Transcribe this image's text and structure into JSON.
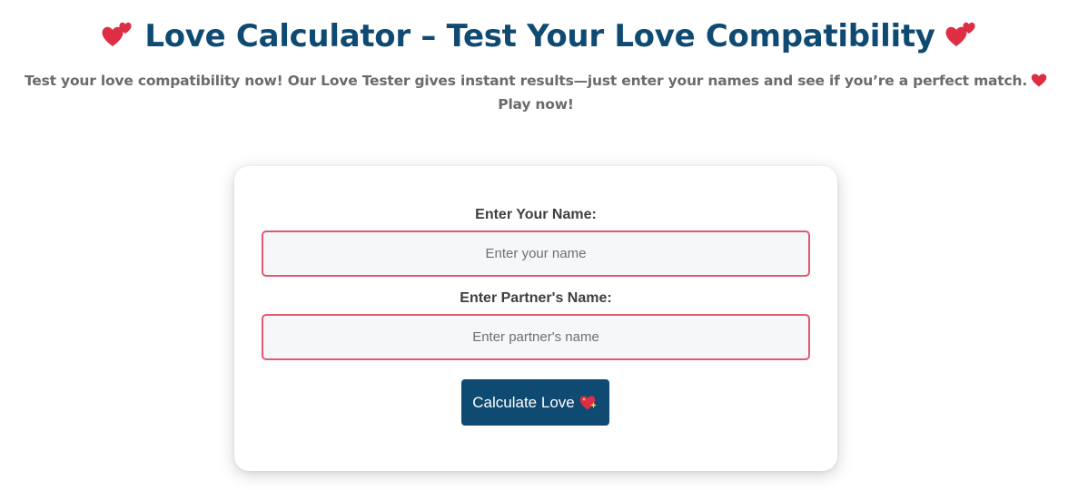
{
  "header": {
    "title": "Love Calculator – Test Your Love Compatibility",
    "left_icon": "two-hearts-icon",
    "right_icon": "two-hearts-icon",
    "subtitle": "Test your love compatibility now! Our Love Tester gives instant results—just enter your names and see if you’re a perfect match.",
    "subtitle_icon": "red-heart-icon",
    "subtitle_end": "Play now!"
  },
  "form": {
    "your_name_label": "Enter Your Name:",
    "your_name_placeholder": "Enter your name",
    "your_name_value": "",
    "partner_name_label": "Enter Partner's Name:",
    "partner_name_placeholder": "Enter partner's name",
    "partner_name_value": "",
    "button_label": "Calculate Love",
    "button_icon": "sparkling-heart-icon"
  },
  "colors": {
    "title": "#0f4a72",
    "subtitle": "#6b6b6b",
    "button_background": "#0f4a72",
    "input_border": "#e05a73",
    "input_background": "#f6f7f9",
    "heart": "#dd2e44"
  }
}
